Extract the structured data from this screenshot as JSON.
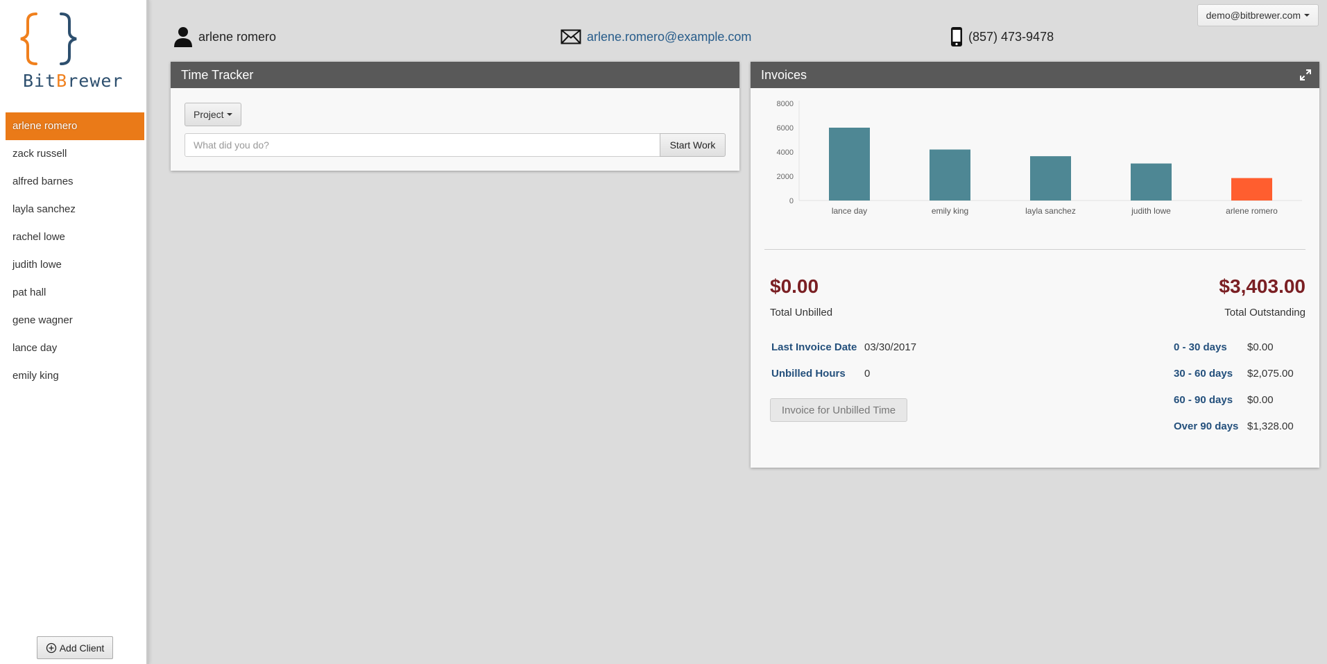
{
  "app": {
    "logo_text_a": "Bit",
    "logo_text_b": "B",
    "logo_text_c": "rewer",
    "brand_orange": "#f0801d",
    "brand_blue": "#2d4f6e"
  },
  "user_menu": {
    "label": "demo@bitbrewer.com"
  },
  "sidebar": {
    "clients": [
      {
        "label": "arlene romero",
        "active": true
      },
      {
        "label": "zack russell"
      },
      {
        "label": "alfred barnes"
      },
      {
        "label": "layla sanchez"
      },
      {
        "label": "rachel lowe"
      },
      {
        "label": "judith lowe"
      },
      {
        "label": "pat hall"
      },
      {
        "label": "gene wagner"
      },
      {
        "label": "lance day"
      },
      {
        "label": "emily king"
      }
    ],
    "add_client_label": "Add Client"
  },
  "client": {
    "name": "arlene romero",
    "email": "arlene.romero@example.com",
    "phone": "(857) 473-9478",
    "icons": {
      "name": "person-icon",
      "email": "envelope-icon",
      "phone": "mobile-phone-icon"
    }
  },
  "time_tracker": {
    "title": "Time Tracker",
    "project_label": "Project",
    "input_placeholder": "What did you do?",
    "start_label": "Start Work"
  },
  "invoices": {
    "title": "Invoices",
    "total_unbilled": "$0.00",
    "total_unbilled_label": "Total Unbilled",
    "total_outstanding": "$3,403.00",
    "total_outstanding_label": "Total Outstanding",
    "last_invoice_label": "Last Invoice Date",
    "last_invoice_value": "03/30/2017",
    "unbilled_hours_label": "Unbilled Hours",
    "unbilled_hours_value": "0",
    "invoice_button_label": "Invoice for Unbilled Time",
    "aging": [
      {
        "label": "0 - 30 days",
        "value": "$0.00"
      },
      {
        "label": "30 - 60 days",
        "value": "$2,075.00"
      },
      {
        "label": "60 - 90 days",
        "value": "$0.00"
      },
      {
        "label": "Over 90 days",
        "value": "$1,328.00"
      }
    ],
    "amount_color": "#7a1f23",
    "label_color": "#24507c"
  },
  "chart_data": {
    "type": "bar",
    "categories": [
      "lance day",
      "emily king",
      "layla sanchez",
      "judith lowe",
      "arlene romero"
    ],
    "values": [
      6000,
      4200,
      3650,
      3050,
      1850
    ],
    "highlight_category": "arlene romero",
    "bar_color": "#4e8794",
    "highlight_color": "#ff5e2f",
    "yticks": [
      0,
      2000,
      4000,
      6000,
      8000
    ],
    "ylim": [
      0,
      8000
    ],
    "title": "",
    "xlabel": "",
    "ylabel": "",
    "grid": false
  }
}
